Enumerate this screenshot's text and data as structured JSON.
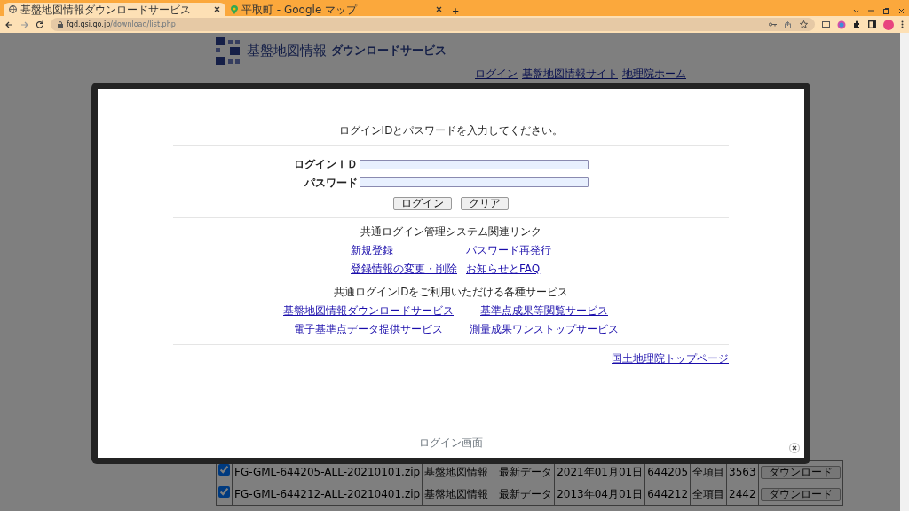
{
  "browser": {
    "tabs": [
      {
        "title": "基盤地図情報ダウンロードサービス",
        "selected": true,
        "kind": "globe"
      },
      {
        "title": "平取町 - Google マップ",
        "selected": false,
        "kind": "pin"
      }
    ],
    "new_tab": "+",
    "url_host": "fgd.gsi.go.jp",
    "url_path": "/download/list.php"
  },
  "page": {
    "site_title": "基盤地図情報",
    "site_subtitle": "ダウンロードサービス",
    "header_links": [
      "ログイン",
      "基盤地図情報サイト",
      "地理院ホーム"
    ],
    "rows": [
      {
        "checked": true,
        "file": "FG-GML-644205-ALL-20210101.zip",
        "type": "基盤地図情報　最新データ",
        "date": "2021年01月01日",
        "code": "644205",
        "item": "全項目",
        "size": "3563",
        "button": "ダウンロード"
      },
      {
        "checked": true,
        "file": "FG-GML-644212-ALL-20210401.zip",
        "type": "基盤地図情報　最新データ",
        "date": "2013年04月01日",
        "code": "644212",
        "item": "全項目",
        "size": "2442",
        "button": "ダウンロード"
      }
    ]
  },
  "modal": {
    "instruction": "ログインIDとパスワードを入力してください。",
    "fields": [
      {
        "label": "ログインＩＤ"
      },
      {
        "label": "パスワード"
      }
    ],
    "buttons": [
      "ログイン",
      "クリア"
    ],
    "related_heading": "共通ログイン管理システム関連リンク",
    "related_links": [
      "新規登録",
      "パスワード再発行",
      "登録情報の変更・削除",
      "お知らせとFAQ"
    ],
    "services_heading": "共通ログインIDをご利用いただける各種サービス",
    "service_links": [
      "基盤地図情報ダウンロードサービス",
      "基準点成果等閲覧サービス",
      "電子基準点データ提供サービス",
      "測量成果ワンストップサービス"
    ],
    "top_link": "国土地理院トップページ",
    "caption": "ログイン画面"
  }
}
